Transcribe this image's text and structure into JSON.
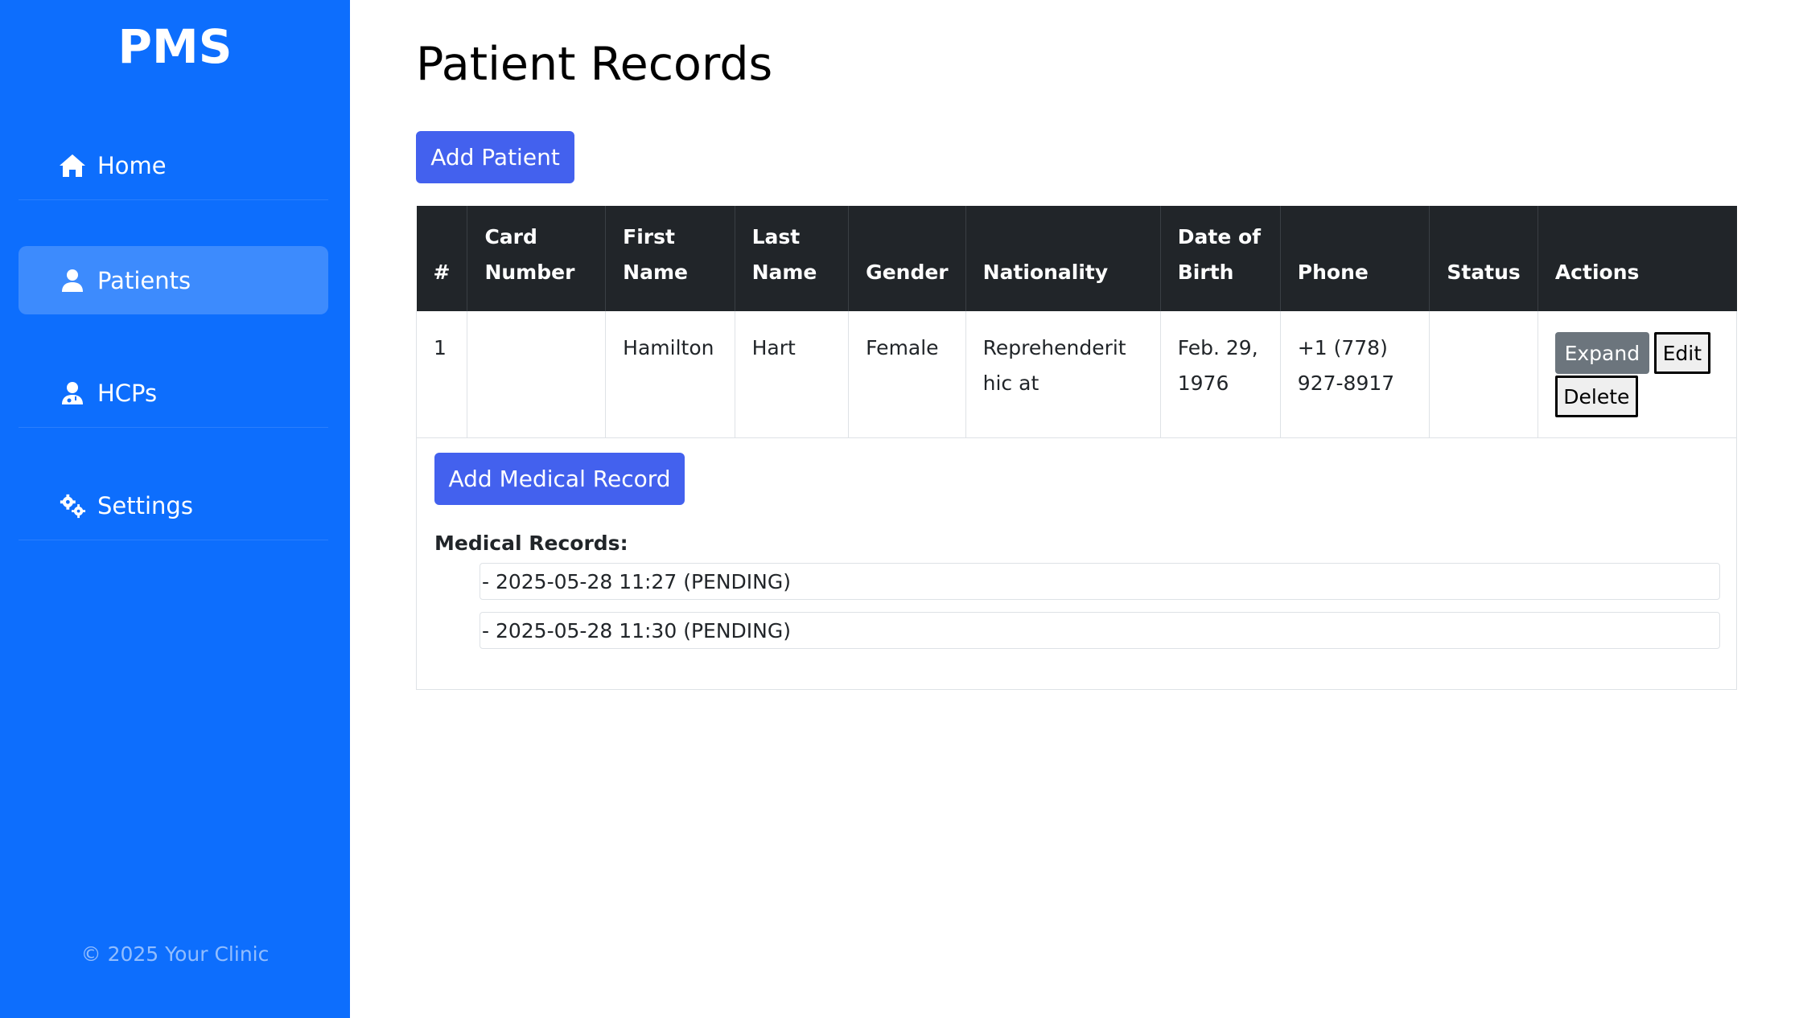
{
  "sidebar": {
    "brand": "PMS",
    "items": [
      {
        "label": "Home",
        "icon": "home-icon",
        "active": false
      },
      {
        "label": "Patients",
        "icon": "user-icon",
        "active": true
      },
      {
        "label": "HCPs",
        "icon": "doctor-icon",
        "active": false
      },
      {
        "label": "Settings",
        "icon": "gears-icon",
        "active": false
      }
    ],
    "footer": "© 2025 Your Clinic"
  },
  "main": {
    "title": "Patient Records",
    "add_patient_label": "Add Patient",
    "table": {
      "headers": {
        "num": "#",
        "card_1": "Card",
        "card_2": "Number",
        "first_1": "First",
        "first_2": "Name",
        "last_1": "Last",
        "last_2": "Name",
        "gender": "Gender",
        "nationality": "Nationality",
        "dob_1": "Date of",
        "dob_2": "Birth",
        "phone": "Phone",
        "status": "Status",
        "actions": "Actions"
      },
      "rows": [
        {
          "num": "1",
          "card_number": "",
          "first_name": "Hamilton",
          "last_name": "Hart",
          "gender": "Female",
          "nationality_1": "Reprehenderit",
          "nationality_2": "hic at",
          "dob_1": "Feb. 29,",
          "dob_2": "1976",
          "phone_1": "+1 (778)",
          "phone_2": "927-8917",
          "status": "",
          "expand_label": "Expand",
          "edit_label": "Edit",
          "delete_label": "Delete"
        }
      ]
    },
    "expanded": {
      "add_medical_record_label": "Add Medical Record",
      "medical_records_label": "Medical Records:",
      "records": [
        "- 2025-05-28 11:27 (PENDING)",
        "- 2025-05-28 11:30 (PENDING)"
      ]
    }
  },
  "colors": {
    "sidebar_bg": "#0d6efd",
    "active_item_bg": "#3d8bfd",
    "primary_button": "#4361ee",
    "table_header_bg": "#212529",
    "expand_button": "#6c757d"
  }
}
